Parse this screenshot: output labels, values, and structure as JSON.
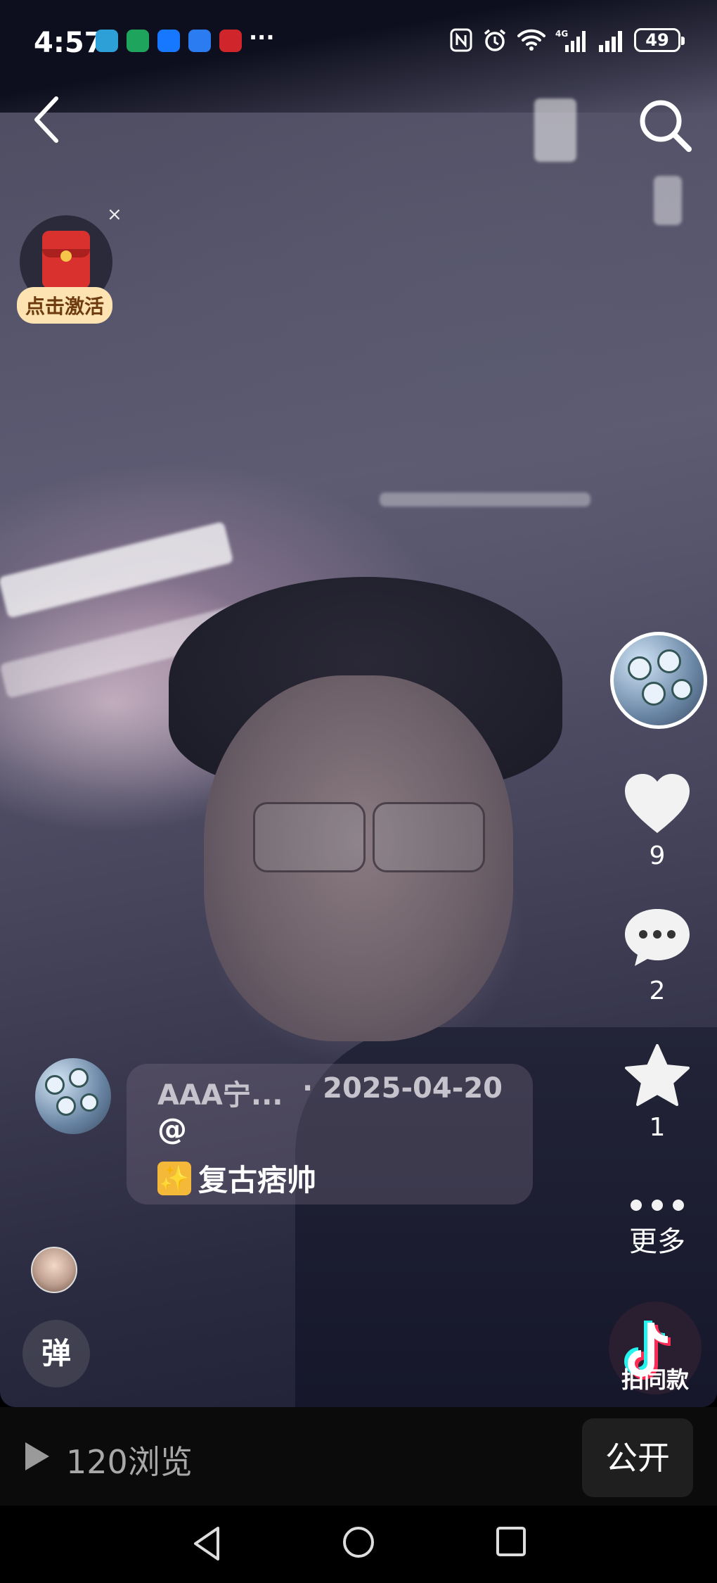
{
  "status_bar": {
    "time": "4:57",
    "more_notifications": "···",
    "battery": "49",
    "network": "4G"
  },
  "widget": {
    "red_packet_label": "点击激活",
    "close": "×"
  },
  "actions": {
    "like_count": "9",
    "comment_count": "2",
    "favorite_count": "1",
    "more_label": "更多",
    "shoot_same_label": "拍同款"
  },
  "caption": {
    "author": "AAA宁...",
    "date": "· 2025-04-20",
    "mention": "@",
    "tag_icon": "✨",
    "tag_text": "复古痞帅"
  },
  "danmu_label": "弹",
  "info_bar": {
    "views": "120浏览",
    "visibility_button": "公开"
  },
  "colors": {
    "red_packet": "#d9322e",
    "label_bg": "#fde3b2",
    "tiktok_cyan": "#25f4ee",
    "tiktok_red": "#fe2c55"
  }
}
